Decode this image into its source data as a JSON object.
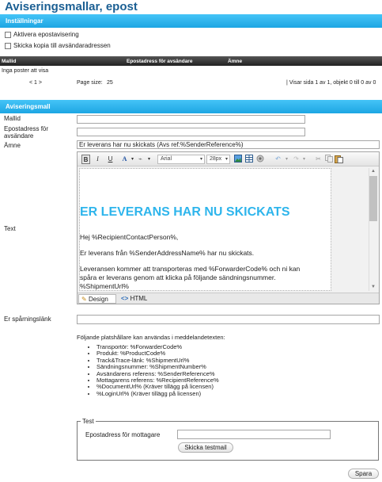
{
  "page": {
    "title": "Aviseringsmallar, epost"
  },
  "settings": {
    "header": "Inställningar",
    "enable_label": "Aktivera epostavisering",
    "copy_label": "Skicka kopia till avsändaradressen"
  },
  "grid": {
    "columns": [
      "Mallid",
      "Epostadress för avsändare",
      "Ämne"
    ],
    "empty_text": "Inga poster att visa",
    "pager_nav": "< 1 >",
    "page_size_label": "Page size:",
    "page_size_value": "25",
    "summary": "| Visar sida 1 av 1, objekt 0 till 0 av 0"
  },
  "template": {
    "header": "Aviseringsmall",
    "mallid_label": "Mallid",
    "mallid_value": "",
    "sender_label_line1": "Epostadress för",
    "sender_label_line2": "avsändare",
    "sender_value": "",
    "subject_label": "Ämne",
    "subject_value": "Er leverans har nu skickats (Avs ref:%SenderReference%)",
    "text_label": "Text",
    "tracking_label": "Er spårningslänk",
    "tracking_value": ""
  },
  "editor": {
    "bold": "B",
    "italic": "I",
    "underline": "U",
    "font_color": "A",
    "font_name": "Arial",
    "font_size": "28px",
    "heading": "ER LEVERANS HAR NU SKICKATS",
    "greeting": "Hej %RecipientContactPerson%,",
    "para1": "Er leverans från %SenderAddressName% har nu skickats.",
    "para2_line1": "Leveransen kommer att transporteras med %ForwarderCode% och ni kan",
    "para2_line2": "spåra er leverans genom att klicka på följande sändningsnummer.",
    "para2_line3": "%ShipmentUrl%",
    "mode_design": "Design",
    "mode_html": "HTML",
    "heading_color": "#2eb5ec"
  },
  "placeholders": {
    "intro": "Följande platshållare kan användas i meddelandetexten:",
    "items": [
      "Transportör: %ForwarderCode%",
      "Produkt: %ProductCode%",
      "Track&Trace-länk: %ShipmentUrl%",
      "Sändningsnummer: %ShipmentNumber%",
      "Avsändarens referens: %SenderReference%",
      "Mottagarens referens: %RecipientReference%",
      "%DocumentUrl% (Kräver tillägg på licensen)",
      "%LoginUrl% (Kräver tillägg på licensen)"
    ]
  },
  "test": {
    "legend": "Test",
    "recipient_label": "Epostadress för mottagare",
    "recipient_value": "",
    "send_button": "Skicka testmail"
  },
  "actions": {
    "save_button": "Spara"
  },
  "colors": {
    "title": "#1b5f93",
    "section_bar": "#1da6e3",
    "grid_header": "#333333"
  }
}
